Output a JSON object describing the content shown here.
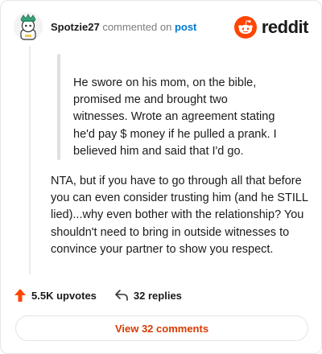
{
  "header": {
    "username": "Spotzie27",
    "commented_on": "commented on",
    "post_link": "post",
    "brand": "reddit",
    "avatar_icon": "snoo-avatar-icon",
    "brand_icon": "reddit-logo-icon",
    "brand_color": "#ff4500",
    "link_color": "#0079d3"
  },
  "quote": {
    "text": "He swore on his mom, on the bible, promised me and brought two witnesses. Wrote an agreement stating he'd pay $ money if he pulled a prank. I believed him and said that I'd go."
  },
  "comment": {
    "text": "NTA, but if you have to go through all that before you can even consider trusting him (and he STILL lied)...why even bother with the relationship? You shouldn't need to bring in outside witnesses to convince your partner to show you respect."
  },
  "actions": {
    "upvotes": "5.5K upvotes",
    "replies": "32 replies",
    "upvote_icon": "upvote-arrow-icon",
    "reply_icon": "reply-arrow-icon",
    "upvote_color": "#ff4500"
  },
  "footer": {
    "view_comments": "View 32 comments",
    "button_text_color": "#d93a00"
  }
}
